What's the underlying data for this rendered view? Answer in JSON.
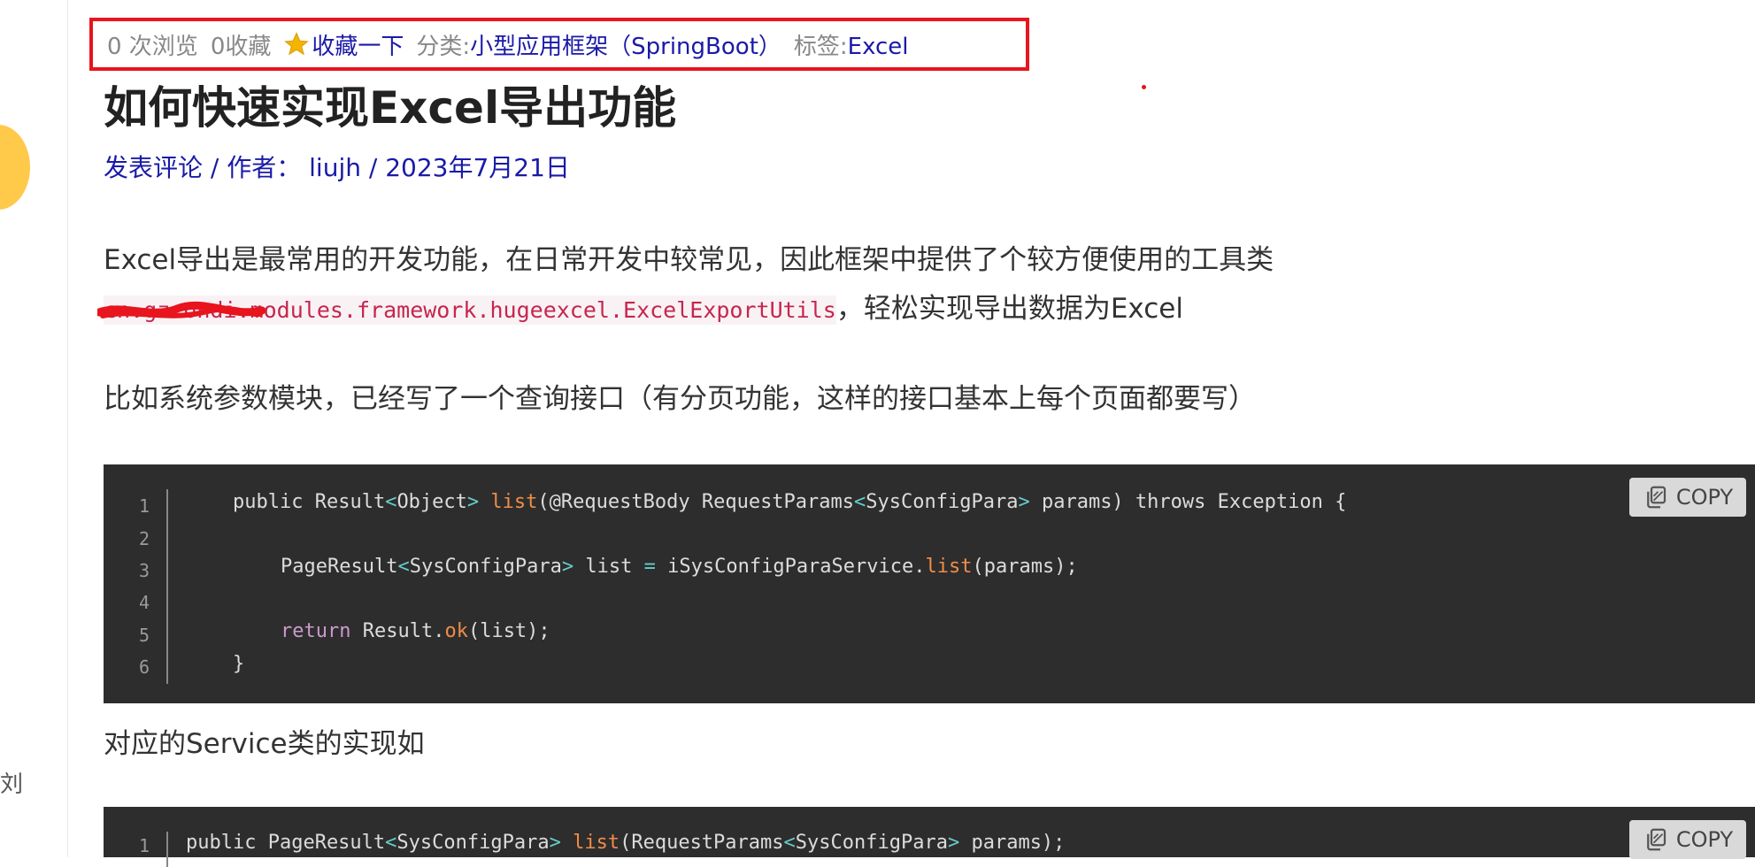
{
  "meta": {
    "views": "0 次浏览",
    "favorites": "0收藏",
    "favorite_action": "收藏一下",
    "category_label": "分类:",
    "category": "小型应用框架（SpringBoot）",
    "tags_label": "标签:",
    "tag": "Excel"
  },
  "post": {
    "title": "如何快速实现Excel导出功能",
    "byline": "发表评论 / 作者： liujh / 2023年7月21日"
  },
  "body": {
    "para1": "Excel导出是最常用的开发功能，在日常开发中较常见，因此框架中提供了个较方便使用的工具类",
    "class_path_redacted": "cn.gzcondi.",
    "class_path": "modules.framework.hugeexcel.ExcelExportUtils",
    "para1_tail": "，轻松实现导出数据为Excel",
    "para2": "比如系统参数模块，已经写了一个查询接口（有分页功能，这样的接口基本上每个页面都要写）",
    "para3": "对应的Service类的实现如"
  },
  "code_block_1": {
    "copy_label": "COPY",
    "line_numbers": [
      "1",
      "2",
      "3",
      "4",
      "5",
      "6"
    ],
    "l1": {
      "a": "public Result",
      "b": "<",
      "c": "Object",
      "d": ">",
      "e": " ",
      "f": "list",
      "g": "(@RequestBody RequestParams",
      "h": "<",
      "i": "SysConfigPara",
      "j": ">",
      "k": " params) throws Exception {"
    },
    "l3": {
      "a": "PageResult",
      "b": "<",
      "c": "SysConfigPara",
      "d": ">",
      "e": " list ",
      "f": "=",
      "g": " iSysConfigParaService.",
      "h": "list",
      "i": "(params);"
    },
    "l5": {
      "a": "return",
      "b": " Result.",
      "c": "ok",
      "d": "(list);"
    },
    "l6": "}"
  },
  "code_block_2": {
    "copy_label": "COPY",
    "line_numbers": [
      "1"
    ],
    "l1": {
      "a": "public PageResult",
      "b": "<",
      "c": "SysConfigPara",
      "d": ">",
      "e": " ",
      "f": "list",
      "g": "(RequestParams",
      "h": "<",
      "i": "SysConfigPara",
      "j": ">",
      "k": " params);"
    }
  },
  "left_edge_text": "刘",
  "colors": {
    "link": "#1a1aa8",
    "highlight_border": "#e8141e",
    "code_bg": "#2d2d2d",
    "code_function": "#f08d49",
    "code_keyword": "#cc99cd",
    "inline_code": "#c7254e"
  }
}
